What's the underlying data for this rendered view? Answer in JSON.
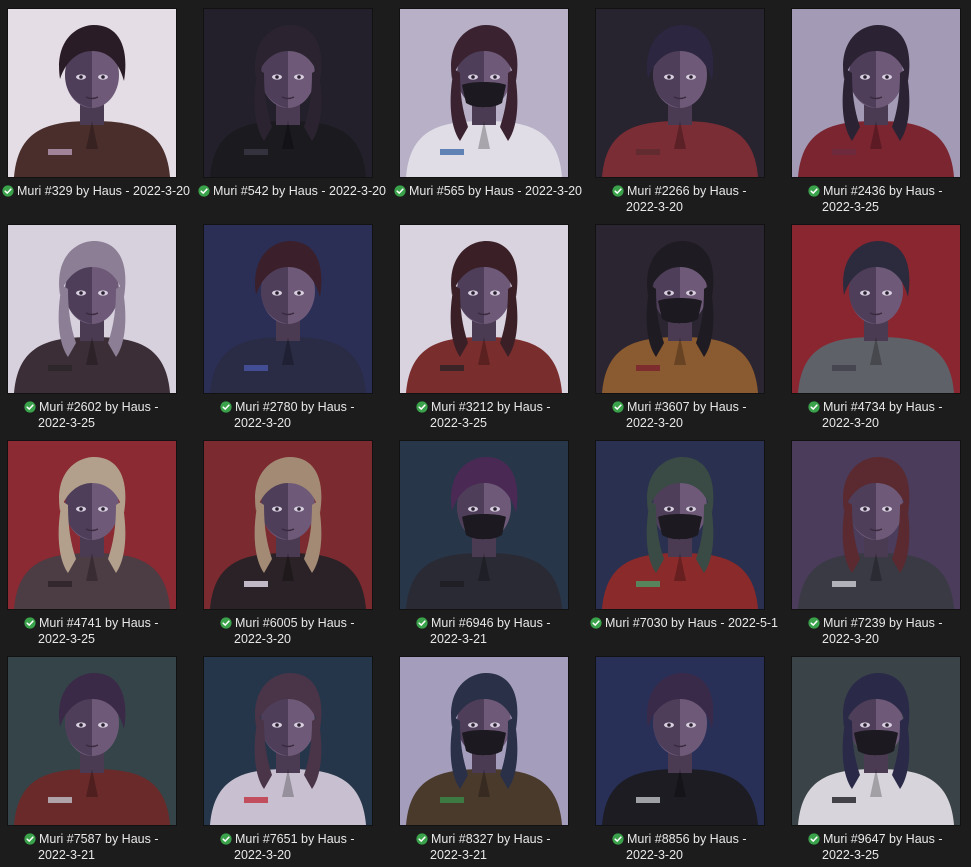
{
  "gallery": {
    "items": [
      {
        "name": "Muri #329 by Haus - 2022-3-20",
        "line1": "Muri #329 by Haus - 2022-3-20",
        "line2": "",
        "bg": "#e4dde6",
        "shirt": "#4a2e2c",
        "hair": "#2a1c26",
        "accent": "#b89ab6"
      },
      {
        "name": "Muri #542 by Haus - 2022-3-20",
        "line1": "Muri #542 by Haus - 2022-3-20",
        "line2": "",
        "bg": "#23202b",
        "shirt": "#1a1a1f",
        "hair": "#2b2430",
        "accent": "#3c3848"
      },
      {
        "name": "Muri #565 by Haus - 2022-3-20",
        "line1": "Muri #565 by Haus - 2022-3-20",
        "line2": "",
        "bg": "#b7b0c6",
        "shirt": "#e0dde6",
        "hair": "#3a2230",
        "accent": "#3e6aa8"
      },
      {
        "name": "Muri #2266 by Haus - 2022-3-20",
        "line1": "Muri #2266 by Haus -",
        "line2": "2022-3-20",
        "bg": "#27232f",
        "shirt": "#7a2d35",
        "hair": "#2c2640",
        "accent": "#5b2a30"
      },
      {
        "name": "Muri #2436 by Haus - 2022-3-25",
        "line1": "Muri #2436 by Haus -",
        "line2": "2022-3-25",
        "bg": "#a39ab5",
        "shirt": "#7b2530",
        "hair": "#2b2333",
        "accent": "#6a2c40"
      },
      {
        "name": "Muri #2602 by Haus - 2022-3-25",
        "line1": "Muri #2602 by Haus -",
        "line2": "2022-3-25",
        "bg": "#d7d1de",
        "shirt": "#3b2e36",
        "hair": "#8b7e95",
        "accent": "#2a2428"
      },
      {
        "name": "Muri #2780 by Haus - 2022-3-20",
        "line1": "Muri #2780 by Haus -",
        "line2": "2022-3-20",
        "bg": "#2b2f55",
        "shirt": "#2a2b44",
        "hair": "#3b1f2a",
        "accent": "#4a56a8"
      },
      {
        "name": "Muri #3212 by Haus - 2022-3-25",
        "line1": "Muri #3212 by Haus -",
        "line2": "2022-3-25",
        "bg": "#d9d3e0",
        "shirt": "#7a2d2d",
        "hair": "#3a2026",
        "accent": "#2a2226"
      },
      {
        "name": "Muri #3607 by Haus - 2022-3-20",
        "line1": "Muri #3607 by Haus -",
        "line2": "2022-3-20",
        "bg": "#2a2530",
        "shirt": "#8a5a30",
        "hair": "#1f1b22",
        "accent": "#7a2230"
      },
      {
        "name": "Muri #4734 by Haus - 2022-3-20",
        "line1": "Muri #4734 by Haus -",
        "line2": "2022-3-20",
        "bg": "#8a2630",
        "shirt": "#5f6168",
        "hair": "#2c2a3d",
        "accent": "#3f4048"
      },
      {
        "name": "Muri #4741 by Haus - 2022-3-25",
        "line1": "Muri #4741 by Haus -",
        "line2": "2022-3-25",
        "bg": "#8b2a32",
        "shirt": "#4c3c44",
        "hair": "#b3a08c",
        "accent": "#2c2228"
      },
      {
        "name": "Muri #6005 by Haus - 2022-3-20",
        "line1": "Muri #6005 by Haus -",
        "line2": "2022-3-20",
        "bg": "#7b2a30",
        "shirt": "#2a2226",
        "hair": "#a28a74",
        "accent": "#e8e0f0"
      },
      {
        "name": "Muri #6946 by Haus - 2022-3-21",
        "line1": "Muri #6946 by Haus -",
        "line2": "2022-3-21",
        "bg": "#273648",
        "shirt": "#2a2a34",
        "hair": "#4a2a55",
        "accent": "#1d1d22"
      },
      {
        "name": "Muri #7030 by Haus - 2022-5-1",
        "line1": "Muri #7030 by Haus - 2022-5-1",
        "line2": "",
        "bg": "#2a3050",
        "shirt": "#8a2a2a",
        "hair": "#3a4a44",
        "accent": "#4a9a6a"
      },
      {
        "name": "Muri #7239 by Haus - 2022-3-20",
        "line1": "Muri #7239 by Haus -",
        "line2": "2022-3-20",
        "bg": "#4a3c5a",
        "shirt": "#3a3a44",
        "hair": "#5a2a30",
        "accent": "#d0d0d8"
      },
      {
        "name": "Muri #7587 by Haus - 2022-3-21",
        "line1": "Muri #7587 by Haus -",
        "line2": "2022-3-21",
        "bg": "#354448",
        "shirt": "#6a2a2a",
        "hair": "#3a2a48",
        "accent": "#c0c0c8"
      },
      {
        "name": "Muri #7651 by Haus - 2022-3-20",
        "line1": "Muri #7651 by Haus -",
        "line2": "2022-3-20",
        "bg": "#26364a",
        "shirt": "#c8c0d0",
        "hair": "#4a3448",
        "accent": "#c03040"
      },
      {
        "name": "Muri #8327 by Haus - 2022-3-21",
        "line1": "Muri #8327 by Haus -",
        "line2": "2022-3-21",
        "bg": "#a49ebc",
        "shirt": "#4a3a2c",
        "hair": "#2a3048",
        "accent": "#3a8a4a"
      },
      {
        "name": "Muri #8856 by Haus - 2022-3-20",
        "line1": "Muri #8856 by Haus -",
        "line2": "2022-3-20",
        "bg": "#283058",
        "shirt": "#1c1c22",
        "hair": "#3a2a4a",
        "accent": "#c0c0c8"
      },
      {
        "name": "Muri #9647 by Haus - 2022-3-25",
        "line1": "Muri #9647 by Haus -",
        "line2": "2022-3-25",
        "bg": "#3a4448",
        "shirt": "#d8d4dc",
        "hair": "#2a2a48",
        "accent": "#1c1c22"
      }
    ],
    "check_color": "#3aa24a",
    "background": "#1c1c1c"
  }
}
